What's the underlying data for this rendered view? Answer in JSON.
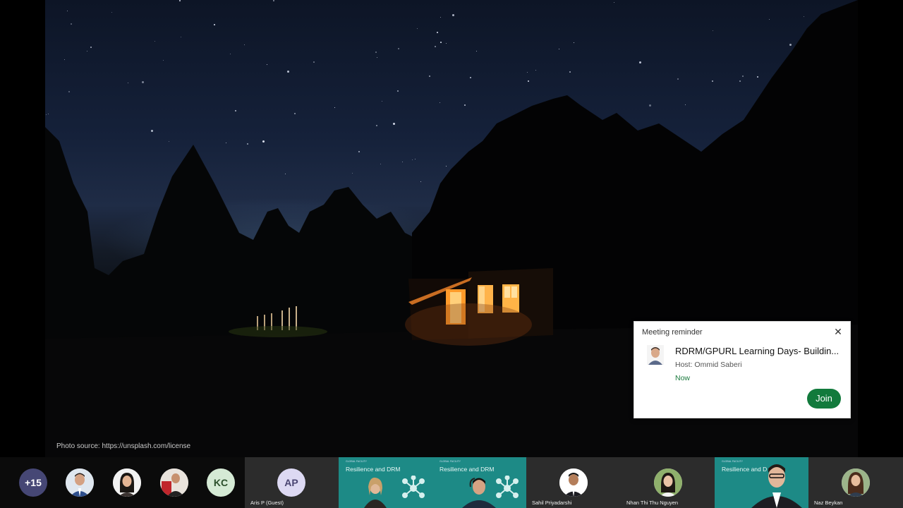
{
  "slide": {
    "caption": "Photo source: https://unsplash.com/license"
  },
  "reminder": {
    "title": "Meeting reminder",
    "close_icon": "close-icon",
    "meeting_name": "RDRM/GPURL Learning Days- Buildin...",
    "host": "Host: Ommid Saberi",
    "when": "Now",
    "join_label": "Join",
    "join_color": "#127a3c"
  },
  "participants": {
    "overflow_count": "+15",
    "overflow_color": "#464775",
    "initials_avatar": "KC",
    "initials_color": "#d5ead5",
    "tiles": [
      {
        "name": "Aris P (Guest)",
        "initials": "AP"
      },
      {
        "name": "",
        "slide_title": "Resilience and DRM"
      },
      {
        "name": "",
        "slide_title": "Resilience and DRM"
      },
      {
        "name": "Sahil Priyadarshi"
      },
      {
        "name": "Nhan Thi Thu Nguyen"
      },
      {
        "name": "",
        "slide_title": "Resilience and D"
      },
      {
        "name": "Naz Beykan"
      }
    ]
  }
}
